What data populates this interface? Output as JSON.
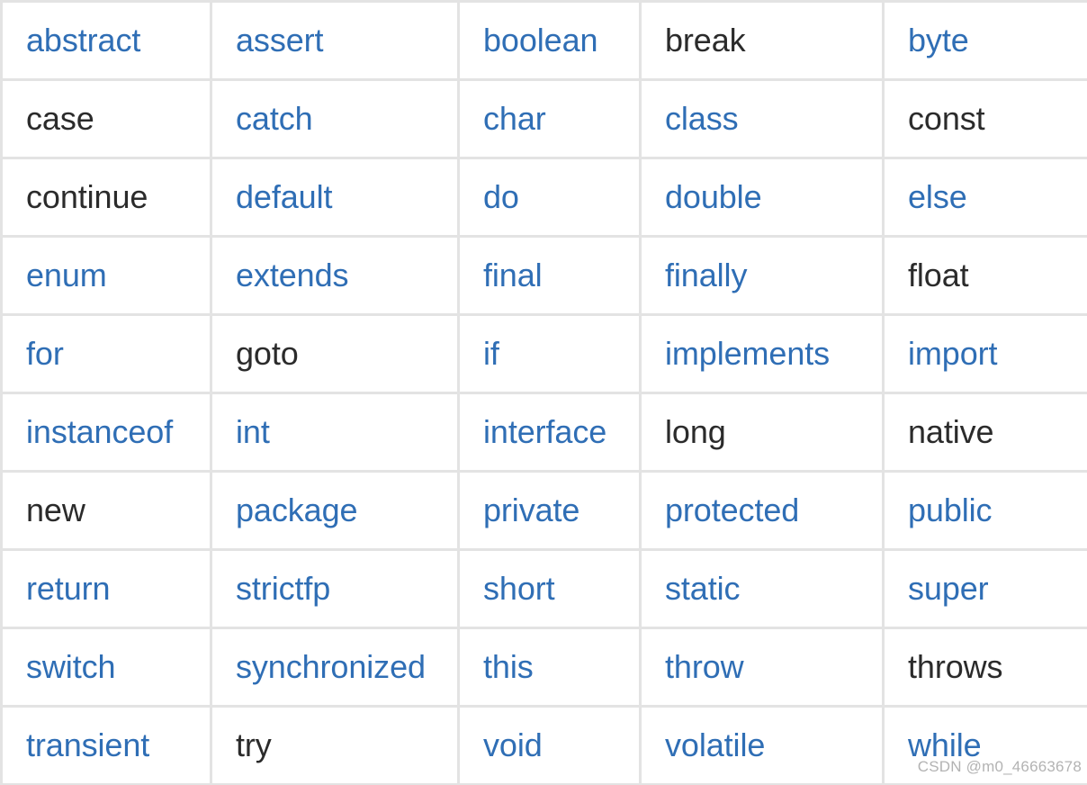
{
  "document": {
    "title": "Java Keywords Table",
    "colors": {
      "link": "#2f6eb5",
      "plain": "#2b2b2b",
      "border": "#e3e3e3",
      "watermark": "#b3b3b3",
      "background": "#ffffff"
    }
  },
  "watermark": {
    "text": "CSDN @m0_46663678"
  },
  "table": {
    "columns": 5,
    "rows_count": 10,
    "rows": [
      [
        {
          "label": "abstract",
          "style": "link"
        },
        {
          "label": "assert",
          "style": "link"
        },
        {
          "label": "boolean",
          "style": "link"
        },
        {
          "label": "break",
          "style": "plain"
        },
        {
          "label": "byte",
          "style": "link"
        }
      ],
      [
        {
          "label": "case",
          "style": "plain"
        },
        {
          "label": "catch",
          "style": "link"
        },
        {
          "label": "char",
          "style": "link"
        },
        {
          "label": "class",
          "style": "link"
        },
        {
          "label": "const",
          "style": "plain"
        }
      ],
      [
        {
          "label": "continue",
          "style": "plain"
        },
        {
          "label": "default",
          "style": "link"
        },
        {
          "label": "do",
          "style": "link"
        },
        {
          "label": "double",
          "style": "link"
        },
        {
          "label": "else",
          "style": "link"
        }
      ],
      [
        {
          "label": "enum",
          "style": "link"
        },
        {
          "label": "extends",
          "style": "link"
        },
        {
          "label": "final",
          "style": "link"
        },
        {
          "label": "finally",
          "style": "link"
        },
        {
          "label": "float",
          "style": "plain"
        }
      ],
      [
        {
          "label": "for",
          "style": "link"
        },
        {
          "label": "goto",
          "style": "plain"
        },
        {
          "label": "if",
          "style": "link"
        },
        {
          "label": "implements",
          "style": "link"
        },
        {
          "label": "import",
          "style": "link"
        }
      ],
      [
        {
          "label": "instanceof",
          "style": "link"
        },
        {
          "label": "int",
          "style": "link"
        },
        {
          "label": "interface",
          "style": "link"
        },
        {
          "label": "long",
          "style": "plain"
        },
        {
          "label": "native",
          "style": "plain"
        }
      ],
      [
        {
          "label": "new",
          "style": "plain"
        },
        {
          "label": "package",
          "style": "link"
        },
        {
          "label": "private",
          "style": "link"
        },
        {
          "label": "protected",
          "style": "link"
        },
        {
          "label": "public",
          "style": "link"
        }
      ],
      [
        {
          "label": "return",
          "style": "link"
        },
        {
          "label": "strictfp",
          "style": "link"
        },
        {
          "label": "short",
          "style": "link"
        },
        {
          "label": "static",
          "style": "link"
        },
        {
          "label": "super",
          "style": "link"
        }
      ],
      [
        {
          "label": "switch",
          "style": "link"
        },
        {
          "label": "synchronized",
          "style": "link"
        },
        {
          "label": "this",
          "style": "link"
        },
        {
          "label": "throw",
          "style": "link"
        },
        {
          "label": "throws",
          "style": "plain"
        }
      ],
      [
        {
          "label": "transient",
          "style": "link"
        },
        {
          "label": "try",
          "style": "plain"
        },
        {
          "label": "void",
          "style": "link"
        },
        {
          "label": "volatile",
          "style": "link"
        },
        {
          "label": "while",
          "style": "link"
        }
      ]
    ]
  }
}
